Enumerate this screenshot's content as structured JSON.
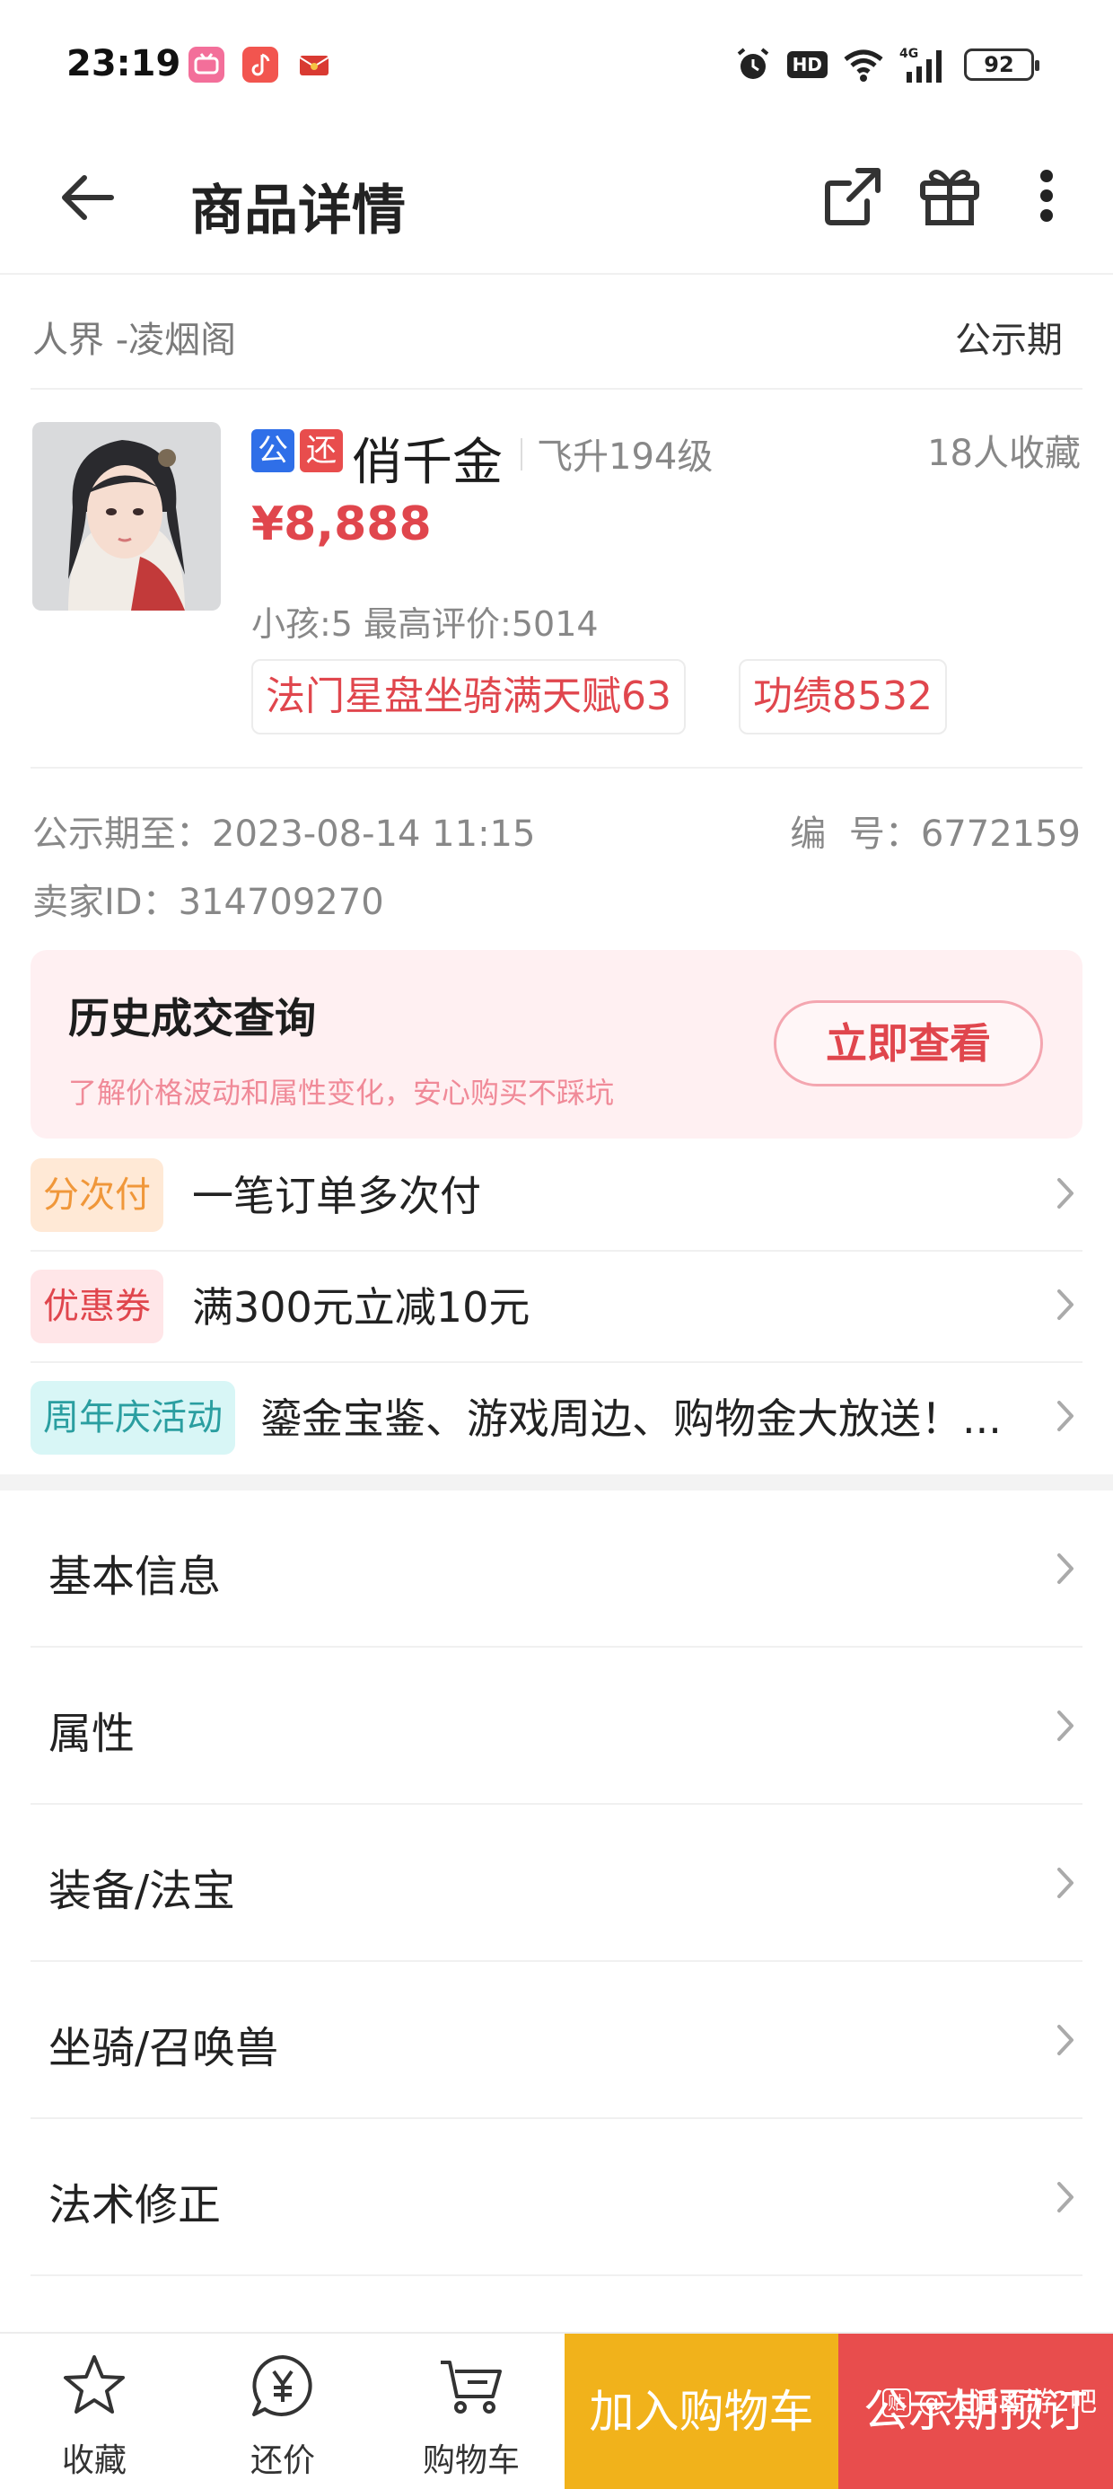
{
  "status_bar": {
    "time": "23:19",
    "hd": "HD",
    "network": "4G",
    "battery": "92",
    "app_icons": [
      "bilibili-icon",
      "music-icon",
      "red-envelope-icon"
    ]
  },
  "header": {
    "title": "商品详情",
    "icons": [
      "back-arrow-icon",
      "share-icon",
      "gift-icon",
      "more-icon"
    ]
  },
  "listing": {
    "server": "人界 -凌烟阁",
    "status": "公示期",
    "badge_public": "公",
    "badge_bargain": "还",
    "role_name": "俏千金",
    "level": "飞升194级",
    "favorites": "18人收藏",
    "price": "¥8,888",
    "meta": "小孩:5 最高评价:5014",
    "tags": [
      "法门星盘坐骑满天赋63",
      "功绩8532"
    ],
    "public_until": "公示期至：2023-08-14 11:15",
    "serial": "编  号：6772159",
    "seller_id": "卖家ID：314709270"
  },
  "history": {
    "title": "历史成交查询",
    "subtitle": "了解价格波动和属性变化，安心购买不踩坑",
    "button": "立即查看"
  },
  "promos": [
    {
      "label": "分次付",
      "text": "一笔订单多次付",
      "bg": "#ffe9d6",
      "fg": "#f0973a"
    },
    {
      "label": "优惠券",
      "text": "满300元立减10元",
      "bg": "#ffe6e8",
      "fg": "#e0464d"
    },
    {
      "label": "周年庆活动",
      "text": "鎏金宝鉴、游戏周边、购物金大放送！...",
      "bg": "#d8f6f6",
      "fg": "#2a9ea0"
    }
  ],
  "menu": [
    "基本信息",
    "属性",
    "装备/法宝",
    "坐骑/召唤兽",
    "法术修正"
  ],
  "bottom_bar": {
    "tabs": [
      "收藏",
      "还价",
      "购物车"
    ],
    "cart_button": "加入购物车",
    "reserve_button": "公示期预订",
    "watermark": "@大话西游2吧",
    "watermark_badge": "贴"
  },
  "colors": {
    "accent_red": "#e0464d",
    "cart_yellow": "#f1b21b",
    "reserve_red": "#e84d4d",
    "badge_blue": "#2f6fe8"
  }
}
